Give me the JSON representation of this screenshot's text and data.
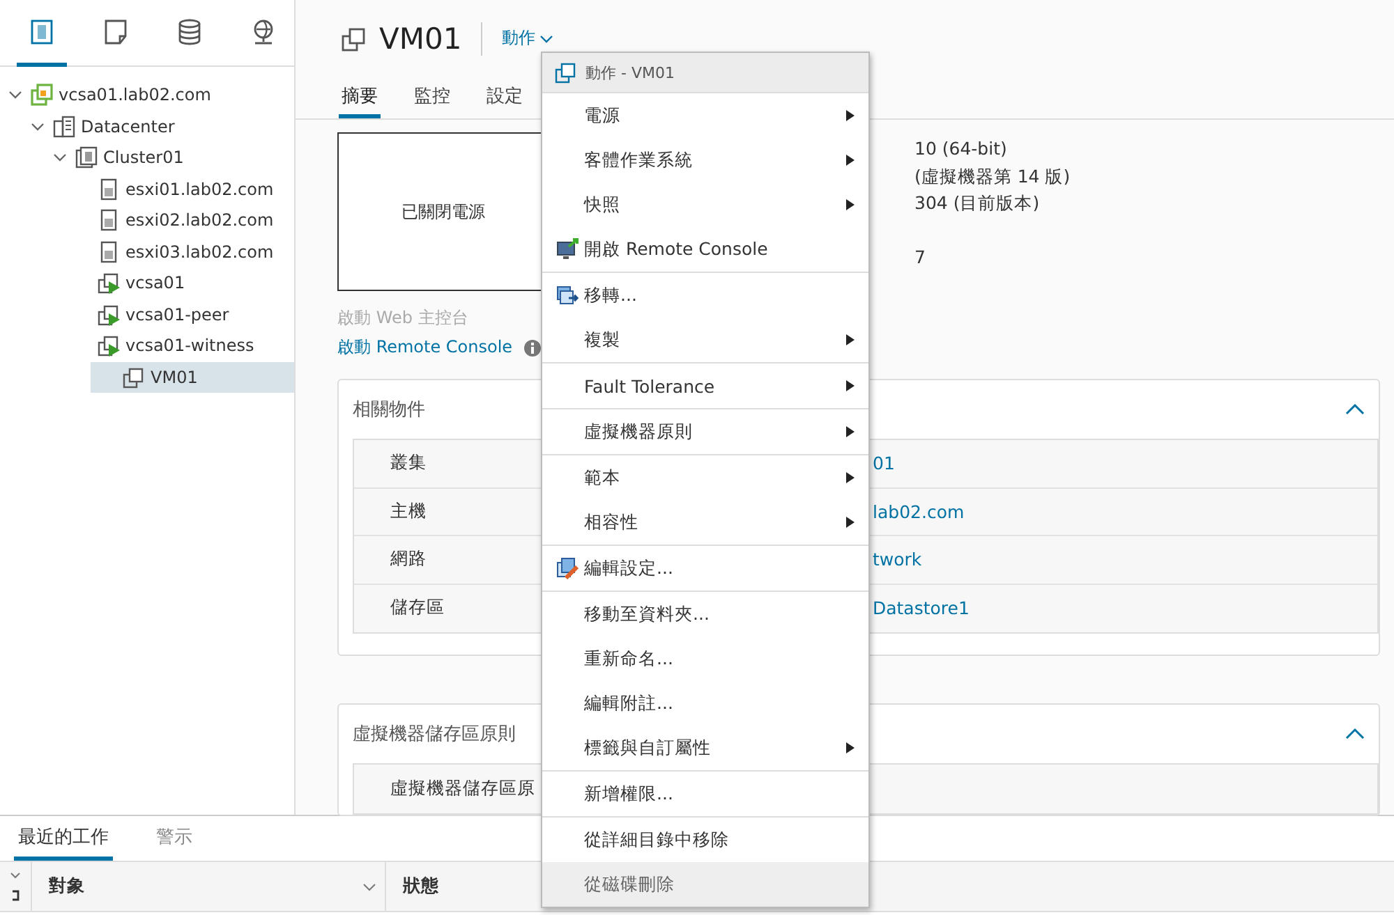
{
  "sidebar": {
    "view_tabs": [
      {
        "kind": "hosts",
        "selected": true
      },
      {
        "kind": "vms",
        "selected": false
      },
      {
        "kind": "storage",
        "selected": false
      },
      {
        "kind": "network",
        "selected": false
      }
    ],
    "tree": [
      {
        "label": "vcsa01.lab02.com",
        "kind": "vcenter",
        "expanded": true,
        "selected": false,
        "children": [
          {
            "label": "Datacenter",
            "kind": "datacenter",
            "expanded": true,
            "selected": false,
            "children": [
              {
                "label": "Cluster01",
                "kind": "cluster",
                "expanded": true,
                "selected": false,
                "children": [
                  {
                    "label": "esxi01.lab02.com",
                    "kind": "host",
                    "selected": false
                  },
                  {
                    "label": "esxi02.lab02.com",
                    "kind": "host",
                    "selected": false
                  },
                  {
                    "label": "esxi03.lab02.com",
                    "kind": "host",
                    "selected": false
                  },
                  {
                    "label": "vcsa01",
                    "kind": "vm_on",
                    "selected": false
                  },
                  {
                    "label": "vcsa01-peer",
                    "kind": "vm_on",
                    "selected": false
                  },
                  {
                    "label": "vcsa01-witness",
                    "kind": "vm_on",
                    "selected": false
                  },
                  {
                    "label": "VM01",
                    "kind": "vm",
                    "selected": true
                  }
                ]
              }
            ]
          }
        ]
      }
    ]
  },
  "header": {
    "title": "VM01",
    "actions_label": "動作"
  },
  "tabs": [
    {
      "label": "摘要",
      "selected": true
    },
    {
      "label": "監控",
      "selected": false
    },
    {
      "label": "設定",
      "selected": false
    }
  ],
  "summary": {
    "console_state": "已關閉電源",
    "info": [
      [
        "10 (64-bit)",
        "(虛擬機器第 14 版)",
        "304 (目前版本)"
      ],
      [
        "7"
      ]
    ],
    "web_console": {
      "label": "啟動 Web 主控台",
      "disabled": true
    },
    "remote_console": {
      "label": "啟動 Remote Console",
      "disabled": false
    }
  },
  "cards": [
    {
      "title": "相關物件",
      "expanded": true,
      "rows": [
        {
          "label": "叢集",
          "value": "01"
        },
        {
          "label": "主機",
          "value": "lab02.com"
        },
        {
          "label": "網路",
          "value": "twork"
        },
        {
          "label": "儲存區",
          "value": "Datastore1"
        }
      ]
    },
    {
      "title": "虛擬機器儲存區原則",
      "expanded": true,
      "rows": [
        {
          "label": "虛擬機器儲存區原"
        }
      ]
    }
  ],
  "context_menu": {
    "title": "動作 - VM01",
    "sections": [
      [
        {
          "label": "電源",
          "submenu": true,
          "kind": "plain",
          "selected": false
        },
        {
          "label": "客體作業系統",
          "submenu": true,
          "kind": "plain",
          "selected": false
        },
        {
          "label": "快照",
          "submenu": true,
          "kind": "plain",
          "selected": false
        },
        {
          "label": "開啟 Remote Console",
          "submenu": false,
          "kind": "console",
          "selected": false
        }
      ],
      [
        {
          "label": "移轉...",
          "submenu": false,
          "kind": "migrate",
          "selected": false
        },
        {
          "label": "複製",
          "submenu": true,
          "kind": "plain",
          "selected": false
        }
      ],
      [
        {
          "label": "Fault Tolerance",
          "submenu": true,
          "kind": "plain",
          "selected": false
        }
      ],
      [
        {
          "label": "虛擬機器原則",
          "submenu": true,
          "kind": "plain",
          "selected": false
        }
      ],
      [
        {
          "label": "範本",
          "submenu": true,
          "kind": "plain",
          "selected": false
        },
        {
          "label": "相容性",
          "submenu": true,
          "kind": "plain",
          "selected": false
        }
      ],
      [
        {
          "label": "編輯設定...",
          "submenu": false,
          "kind": "edit",
          "selected": false
        }
      ],
      [
        {
          "label": "移動至資料夾...",
          "submenu": false,
          "kind": "plain",
          "selected": false
        },
        {
          "label": "重新命名...",
          "submenu": false,
          "kind": "plain",
          "selected": false
        },
        {
          "label": "編輯附註...",
          "submenu": false,
          "kind": "plain",
          "selected": false
        },
        {
          "label": "標籤與自訂屬性",
          "submenu": true,
          "kind": "plain",
          "selected": false
        }
      ],
      [
        {
          "label": "新增權限...",
          "submenu": false,
          "kind": "plain",
          "selected": false
        }
      ],
      [
        {
          "label": "從詳細目錄中移除",
          "submenu": false,
          "kind": "plain",
          "selected": false
        },
        {
          "label": "從磁碟刪除",
          "submenu": false,
          "kind": "plain",
          "selected": true
        }
      ]
    ]
  },
  "bottom_panel": {
    "tabs": [
      {
        "label": "最近的工作",
        "selected": true
      },
      {
        "label": "警示",
        "selected": false
      }
    ],
    "columns": [
      "對象",
      "狀態"
    ]
  }
}
